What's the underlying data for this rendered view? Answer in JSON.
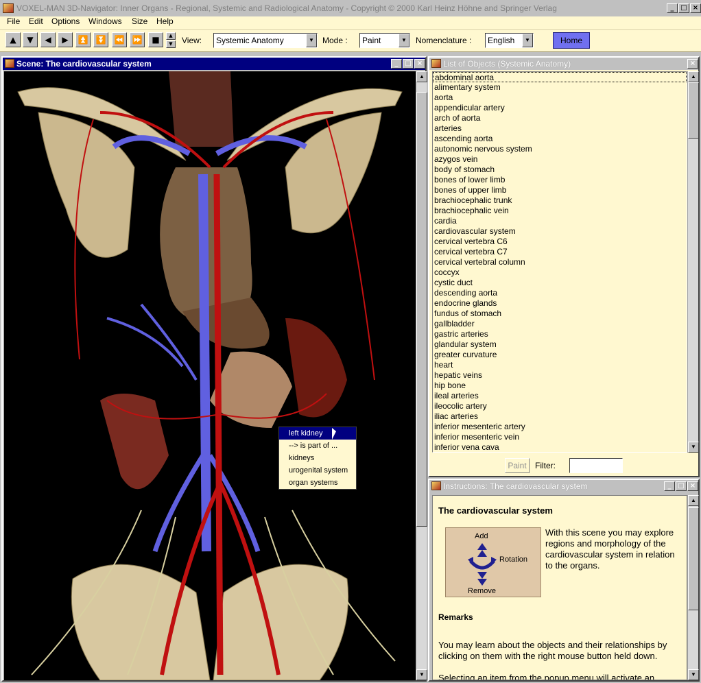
{
  "window": {
    "title": "VOXEL-MAN 3D-Navigator: Inner Organs - Regional, Systemic and Radiological Anatomy - Copyright © 2000 Karl Heinz Höhne and Springer Verlag"
  },
  "menu": {
    "items": [
      "File",
      "Edit",
      "Options",
      "Windows",
      "Size",
      "Help"
    ]
  },
  "toolbar": {
    "nav_glyphs": [
      "▲",
      "▼",
      "◀",
      "▶",
      "⏫",
      "⏬",
      "⏪",
      "⏩",
      "■"
    ],
    "view_label": "View:",
    "view_value": "Systemic Anatomy",
    "mode_label": "Mode :",
    "mode_value": "Paint",
    "nomenclature_label": "Nomenclature :",
    "nomenclature_value": "English",
    "home_label": "Home"
  },
  "scene": {
    "title": "Scene: The cardiovascular system",
    "context_menu": {
      "items": [
        "left kidney",
        "--> is part of ...",
        "kidneys",
        "urogenital system",
        "organ systems"
      ],
      "selected_index": 0
    }
  },
  "objects": {
    "title": "List of Objects (Systemic Anatomy)",
    "items": [
      "abdominal aorta",
      "alimentary system",
      "aorta",
      "appendicular artery",
      "arch of aorta",
      "arteries",
      "ascending aorta",
      "autonomic nervous system",
      "azygos vein",
      "body of stomach",
      "bones of lower limb",
      "bones of upper limb",
      "brachiocephalic trunk",
      "brachiocephalic vein",
      "cardia",
      "cardiovascular system",
      "cervical vertebra C6",
      "cervical vertebra C7",
      "cervical vertebral column",
      "coccyx",
      "cystic duct",
      "descending aorta",
      "endocrine glands",
      "fundus of stomach",
      "gallbladder",
      "gastric arteries",
      "glandular system",
      "greater curvature",
      "heart",
      "hepatic veins",
      "hip bone",
      "ileal arteries",
      "ileocolic artery",
      "iliac arteries",
      "inferior mesenteric artery",
      "inferior mesenteric vein",
      "inferior vena cava"
    ],
    "paint_label": "Paint",
    "filter_label": "Filter:",
    "filter_value": ""
  },
  "instructions": {
    "title": "Instructions: The cardiovascular system",
    "heading": "The cardiovascular system",
    "rotation_labels": {
      "add": "Add",
      "rotation": "Rotation",
      "remove": "Remove"
    },
    "intro": "With this scene you may explore regions and morphology of the cardiovascular system in relation to the organs.",
    "remarks_heading": "Remarks",
    "remark_1": "You may learn about the objects and their relationships by clicking on them with the right mouse button held down.",
    "remark_2": "Selecting an item from the popup menu will activate an"
  },
  "colors": {
    "panel_bg": "#fff8d0",
    "active_title": "#000080",
    "home_button": "#7070f0",
    "artery": "#c01010",
    "vein": "#6060e0",
    "bone": "#d8c8a0"
  }
}
